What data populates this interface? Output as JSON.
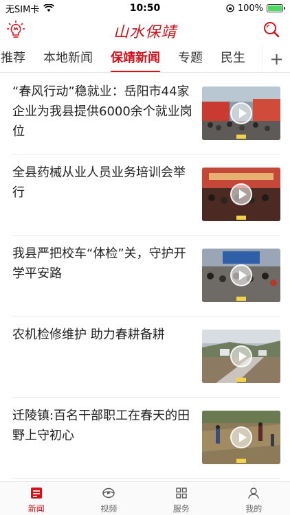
{
  "status_bar": {
    "carrier": "无SIM卡",
    "time": "10:50",
    "battery": "100%",
    "battery_level": 1.0
  },
  "header": {
    "brand": "山水保靖",
    "left_icon": "lightbulb-icon",
    "right_icon": "search-icon"
  },
  "tabs": [
    {
      "label": "推荐",
      "active": false
    },
    {
      "label": "本地新闻",
      "active": false
    },
    {
      "label": "保靖新闻",
      "active": true
    },
    {
      "label": "专题",
      "active": false
    },
    {
      "label": "民生",
      "active": false
    }
  ],
  "tabs_more": "+",
  "news": [
    {
      "title": "“春风行动”稳就业：岳阳市44家企业为我县提供6000余个就业岗位",
      "thumb": "job-fair"
    },
    {
      "title": "全县药械从业人员业务培训会举行",
      "thumb": "meeting-red"
    },
    {
      "title": "我县严把校车“体检”关，守护开学平安路",
      "thumb": "meeting-hall"
    },
    {
      "title": "农机检修维护 助力春耕备耕",
      "thumb": "field"
    },
    {
      "title": "迁陵镇:百名干部职工在春天的田野上守初心",
      "thumb": "farmland"
    }
  ],
  "tabbar": [
    {
      "label": "新闻",
      "icon": "news-icon",
      "active": true
    },
    {
      "label": "视频",
      "icon": "video-icon",
      "active": false
    },
    {
      "label": "服务",
      "icon": "grid-icon",
      "active": false
    },
    {
      "label": "我的",
      "icon": "profile-icon",
      "active": false
    }
  ],
  "colors": {
    "accent": "#d0121b",
    "divider": "#eaeaea"
  }
}
